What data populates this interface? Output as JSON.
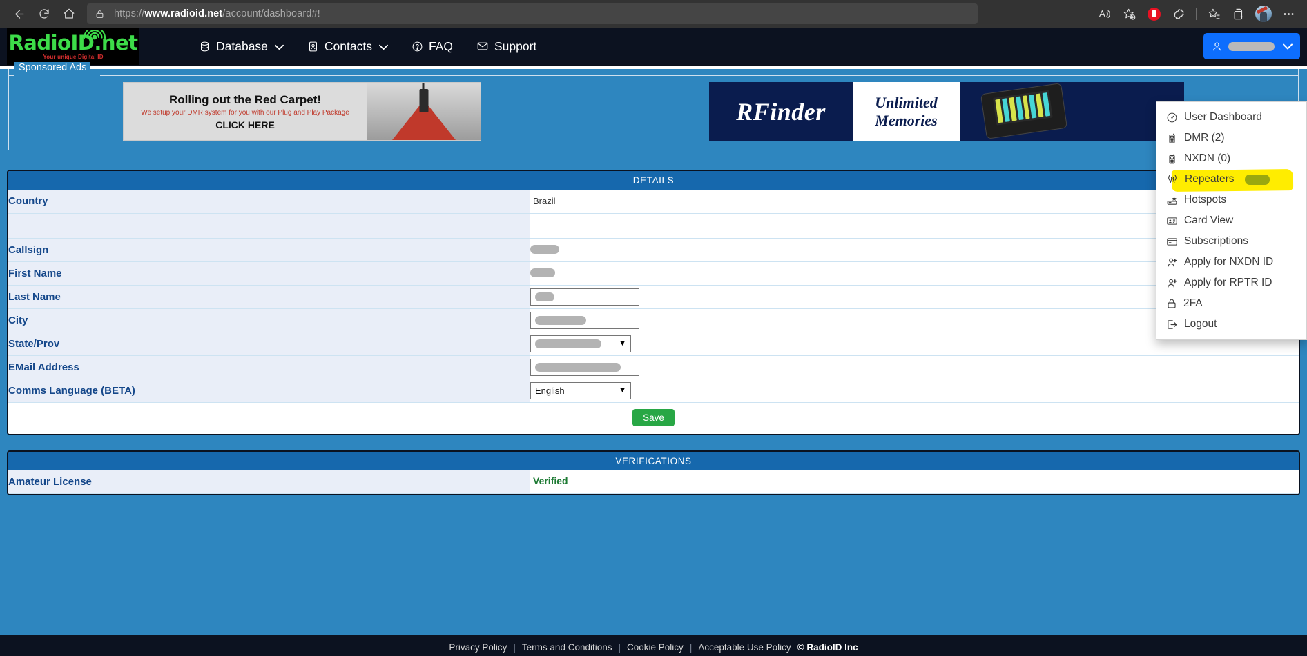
{
  "browser": {
    "url_prefix": "https://",
    "url_domain": "www.radioid.net",
    "url_path": "/account/dashboard#!",
    "back_icon": "back-arrow-icon",
    "reload_icon": "reload-icon",
    "home_icon": "home-icon",
    "lock_icon": "lock-icon",
    "read_aloud_icon": "read-aloud-icon",
    "add_favorite_icon": "add-favorite-icon",
    "extension_red_icon": "extension-icon",
    "extension_puzzle_icon": "puzzle-extension-icon",
    "favorites_icon": "favorites-list-icon",
    "collections_icon": "collections-icon",
    "profile_icon": "profile-avatar-icon",
    "settings_icon": "settings-more-icon"
  },
  "site": {
    "logo_text": "RadioID.net",
    "logo_tagline": "Your unique Digital ID",
    "nav": [
      {
        "label": "Database",
        "icon": "database-icon",
        "has_caret": true
      },
      {
        "label": "Contacts",
        "icon": "contacts-icon",
        "has_caret": true
      },
      {
        "label": "FAQ",
        "icon": "question-circle-icon",
        "has_caret": false
      },
      {
        "label": "Support",
        "icon": "envelope-icon",
        "has_caret": false
      }
    ],
    "user_button": {
      "icon": "person-icon",
      "label_redacted": true,
      "caret": "chevron-down-icon"
    }
  },
  "ads": {
    "legend": "Sponsored Ads",
    "ad1": {
      "headline": "Rolling out the Red Carpet!",
      "subline": "We setup your DMR system for you with our Plug and Play Package",
      "cta": "CLICK HERE"
    },
    "ad2": {
      "brand": "RFinder",
      "line1": "Unlimited",
      "line2": "Memories"
    }
  },
  "details": {
    "title": "DETAILS",
    "rows": [
      {
        "label": "Country",
        "type": "text",
        "value": "Brazil"
      },
      {
        "label": "",
        "type": "spacer",
        "value": ""
      },
      {
        "label": "Callsign",
        "type": "blob",
        "value": "",
        "blob_width": 42
      },
      {
        "label": "First Name",
        "type": "blob",
        "value": "",
        "blob_width": 36
      },
      {
        "label": "Last Name",
        "type": "input",
        "value": "",
        "blob_width": 28
      },
      {
        "label": "City",
        "type": "input",
        "value": "",
        "blob_width": 74
      },
      {
        "label": "State/Prov",
        "type": "select-blob",
        "value": "",
        "blob_width": 96
      },
      {
        "label": "EMail Address",
        "type": "input",
        "value": "",
        "blob_width": 124
      },
      {
        "label": "Comms Language (BETA)",
        "type": "select",
        "value": "English"
      }
    ],
    "save_label": "Save"
  },
  "verifications": {
    "title": "VERIFICATIONS",
    "rows": [
      {
        "label": "Amateur License",
        "value": "Verified"
      }
    ]
  },
  "dropdown": {
    "items": [
      {
        "label": "User Dashboard",
        "icon": "dashboard-gauge-icon",
        "highlighted": false,
        "badge": false
      },
      {
        "label": "DMR (2)",
        "icon": "radio-handset-icon",
        "highlighted": false,
        "badge": false
      },
      {
        "label": "NXDN (0)",
        "icon": "radio-handset-icon",
        "highlighted": false,
        "badge": false
      },
      {
        "label": "Repeaters",
        "icon": "repeater-tower-icon",
        "highlighted": true,
        "badge": true
      },
      {
        "label": "Hotspots",
        "icon": "hotspot-router-icon",
        "highlighted": false,
        "badge": false
      },
      {
        "label": "Card View",
        "icon": "id-card-icon",
        "highlighted": false,
        "badge": false
      },
      {
        "label": "Subscriptions",
        "icon": "credit-card-icon",
        "highlighted": false,
        "badge": false
      },
      {
        "label": "Apply for NXDN ID",
        "icon": "person-plus-icon",
        "highlighted": false,
        "badge": false
      },
      {
        "label": "Apply for RPTR ID",
        "icon": "person-plus-icon",
        "highlighted": false,
        "badge": false
      },
      {
        "label": "2FA",
        "icon": "lock-icon",
        "highlighted": false,
        "badge": false
      },
      {
        "label": "Logout",
        "icon": "logout-icon",
        "highlighted": false,
        "badge": false
      }
    ]
  },
  "footer": {
    "links": [
      "Privacy Policy",
      "Terms and Conditions",
      "Cookie Policy",
      "Acceptable Use Policy"
    ],
    "copyright": "© RadioID Inc"
  },
  "colors": {
    "brand_green": "#3ddc49",
    "page_blue": "#2e86bf",
    "header_dark": "#0c1220",
    "panel_head": "#1668ad",
    "label_blue": "#14478a",
    "save_green": "#28a745",
    "highlight_yellow": "#ffed00",
    "verified_green": "#1d7a33",
    "accent_button": "#0d6efd"
  }
}
